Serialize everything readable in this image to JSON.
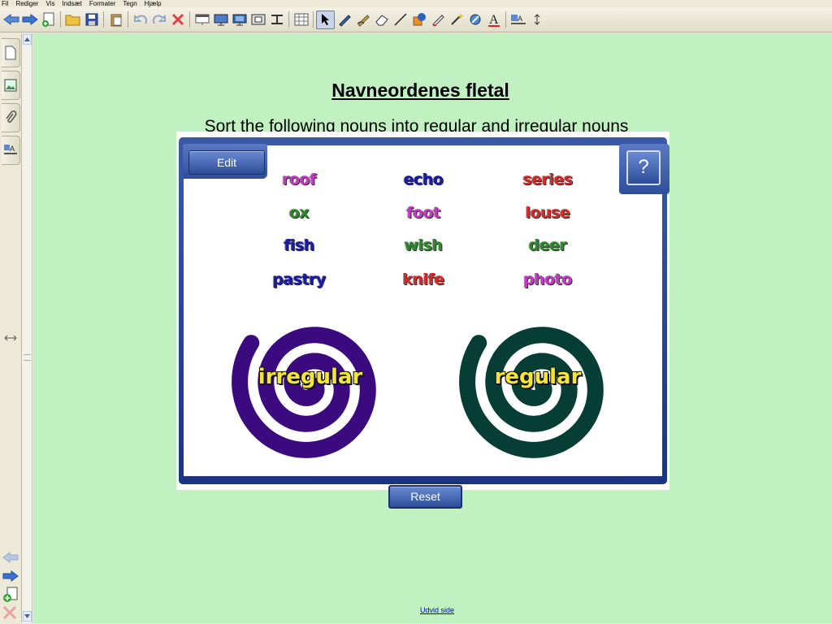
{
  "menu": [
    "Fil",
    "Rediger",
    "Vis",
    "Indsæt",
    "Formater",
    "Tegn",
    "Hjælp"
  ],
  "toolbar_icons": [
    "back-arrow-icon",
    "forward-arrow-icon",
    "add-page-icon",
    "open-folder-icon",
    "save-icon",
    "paste-icon",
    "undo-icon",
    "redo-icon",
    "delete-icon",
    "screen-shade-icon",
    "full-screen-icon",
    "dual-display-icon",
    "capture-icon",
    "pen-tray-icon",
    "table-icon",
    "select-pointer-icon",
    "pen-icon",
    "creative-pen-icon",
    "eraser-icon",
    "line-icon",
    "shapes-icon",
    "fill-icon",
    "magic-pen-icon",
    "shape-recognition-icon",
    "text-icon",
    "properties-icon",
    "more-tools-icon"
  ],
  "page": {
    "title": "Navneordenes fletal",
    "subtitle": "Sort the following nouns into regular and irregular nouns"
  },
  "activity": {
    "edit_label": "Edit",
    "help_label": "?",
    "reset_label": "Reset",
    "words": [
      {
        "text": "roof",
        "color": "#c436c4"
      },
      {
        "text": "echo",
        "color": "#1a1aa8"
      },
      {
        "text": "series",
        "color": "#d62a2a"
      },
      {
        "text": "ox",
        "color": "#2a8a2a"
      },
      {
        "text": "foot",
        "color": "#c436c4"
      },
      {
        "text": "louse",
        "color": "#d62a2a"
      },
      {
        "text": "fish",
        "color": "#1a1aa8"
      },
      {
        "text": "wish",
        "color": "#2a8a2a"
      },
      {
        "text": "deer",
        "color": "#2a8a2a"
      },
      {
        "text": "pastry",
        "color": "#1a1aa8"
      },
      {
        "text": "knife",
        "color": "#d62a2a"
      },
      {
        "text": "photo",
        "color": "#c436c4"
      }
    ],
    "irregular_label": "irregular",
    "regular_label": "regular",
    "irregular_color": "#3b0a7e",
    "regular_color": "#063d35"
  },
  "footer": {
    "expand_link": "Udvid side"
  }
}
